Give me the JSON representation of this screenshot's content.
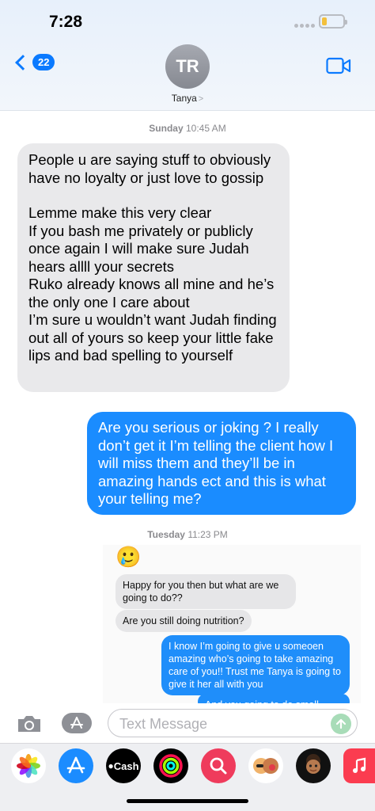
{
  "status": {
    "time": "7:28"
  },
  "header": {
    "unread_count": "22",
    "avatar_initials": "TR",
    "contact_name": "Tanya",
    "chevron": ">"
  },
  "conversation": {
    "stamp1": {
      "day": "Sunday",
      "time": "10:45 AM"
    },
    "incoming": {
      "para1": "People u are saying stuff to obviously have no loyalty or just love to gossip",
      "para2": "Lemme make this very clear\nIf you bash me privately or publicly once again I will make sure Judah hears allll your secrets\nRuko already knows all mine and he’s the only one I care about\nI’m sure u wouldn’t want Judah finding out all of yours so keep your little fake lips and bad spelling to yourself"
    },
    "outgoing": "Are you serious or joking ? I really don’t get it I’m telling the client how I will miss them and they’ll be in amazing hands ect and this is what your telling me?",
    "stamp2": {
      "day": "Tuesday",
      "time": "11:23 PM"
    },
    "attachment": {
      "emoji": "🥲",
      "msg1": "Happy for you then but what are we going to do??",
      "msg2": "Are you still doing nutrition?",
      "msg3": "I know I’m going to give u someoen amazing who’s going to take amazing care of you!! Trust me Tanya is going to give it her all with you",
      "msg4_partial": "And you going to do small"
    }
  },
  "composer": {
    "placeholder": "Text Message"
  },
  "app_drawer": {
    "apps": [
      "photos-icon",
      "app-store-icon",
      "apple-cash-icon",
      "activity-icon",
      "image-search-icon",
      "memoji-sticker-icon",
      "memoji-icon",
      "music-icon"
    ],
    "cash_label": "Cash"
  },
  "colors": {
    "accent": "#0a7aff",
    "outgoing_bubble": "#1a8cff",
    "incoming_bubble": "#e9e9eb"
  }
}
